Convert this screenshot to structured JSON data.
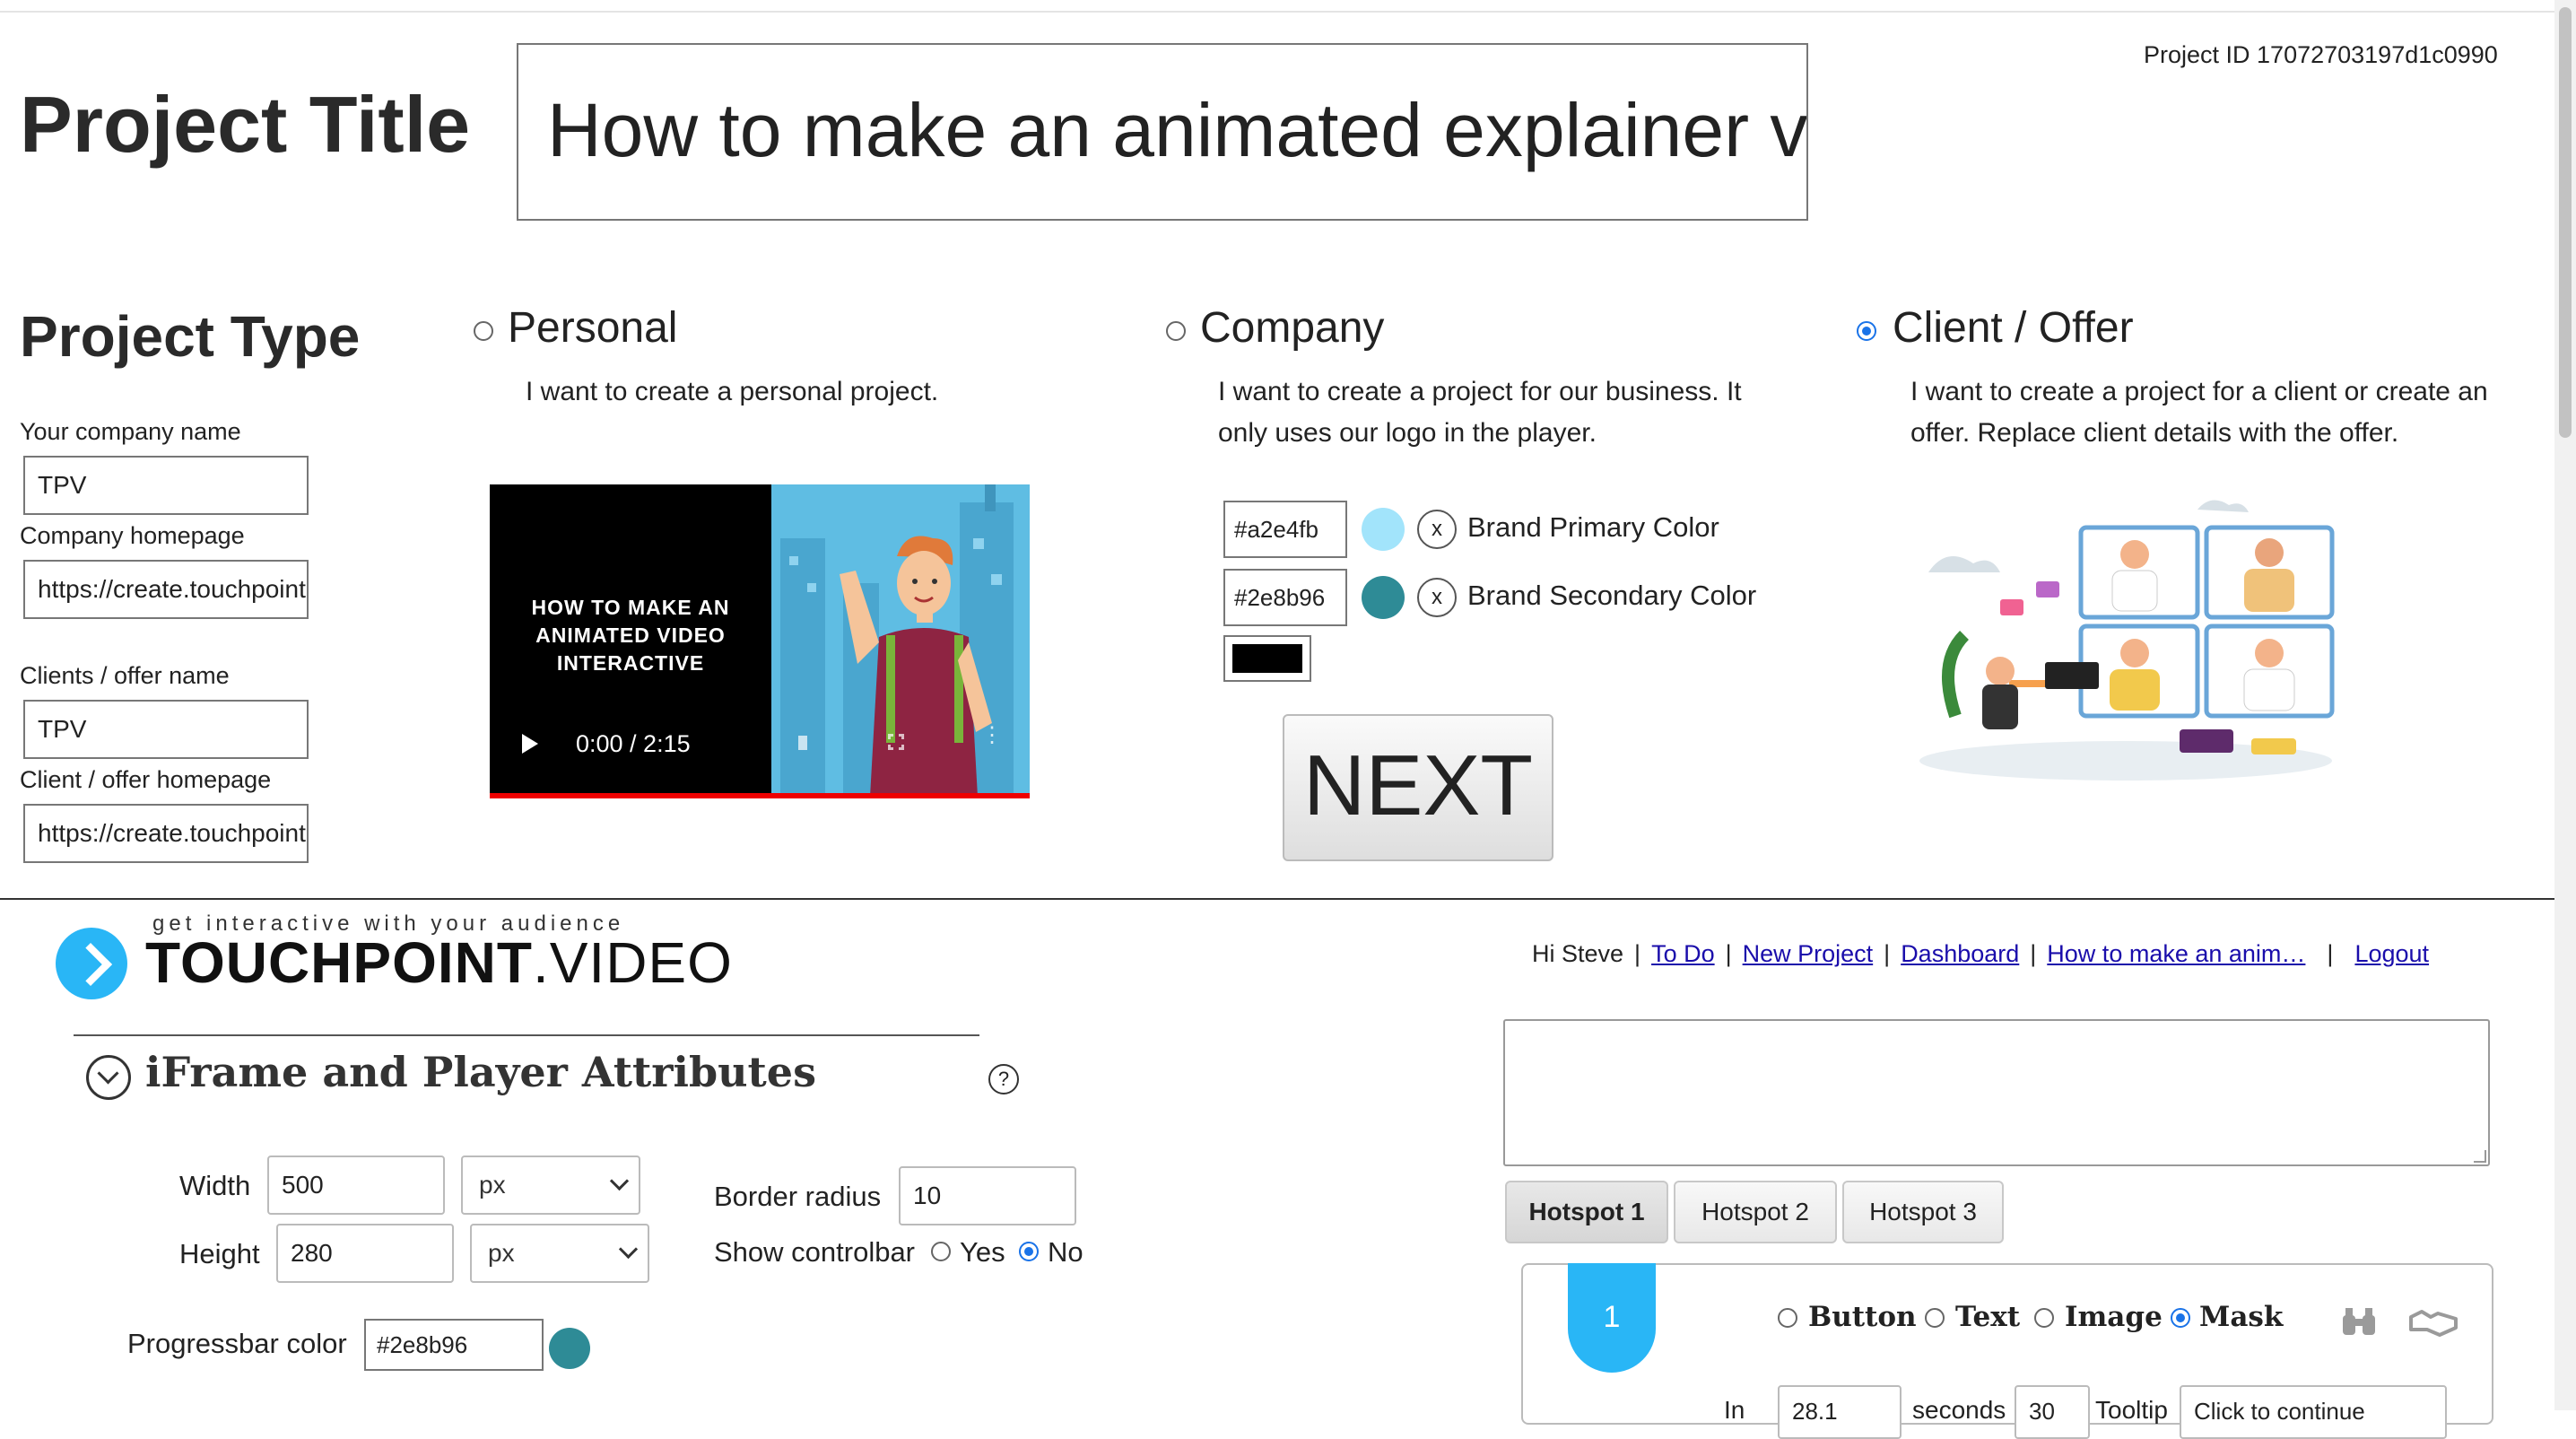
{
  "project": {
    "title_label": "Project Title",
    "title_value": "How to make an animated explainer video interactive",
    "id_text": "Project ID 17072703197d1c0990"
  },
  "project_type": {
    "heading": "Project Type",
    "company_name_label": "Your company name",
    "company_name_value": "TPV",
    "company_homepage_label": "Company homepage",
    "company_homepage_value": "https://create.touchpoint",
    "client_name_label": "Clients / offer name",
    "client_name_value": "TPV",
    "client_homepage_label": "Client / offer homepage",
    "client_homepage_value": "https://create.touchpoint",
    "options": [
      {
        "label": "Personal",
        "desc": "I want to create a personal project.",
        "selected": false
      },
      {
        "label": "Company",
        "desc": "I want to create a project for our business. It only uses our logo in the player.",
        "selected": false
      },
      {
        "label": "Client / Offer",
        "desc": "I want to create a project for a client or create an offer. Replace client details with the offer.",
        "selected": true
      }
    ]
  },
  "video": {
    "caption": "HOW TO MAKE AN ANIMATED VIDEO INTERACTIVE",
    "time": "0:00 / 2:15"
  },
  "brand": {
    "primary_hex": "#a2e4fb",
    "primary_label": "Brand Primary Color",
    "secondary_hex": "#2e8b96",
    "secondary_label": "Brand Secondary Color",
    "third_color": "#000000",
    "remove_glyph": "x"
  },
  "next_label": "NEXT",
  "header": {
    "tagline": "get interactive with your audience",
    "logo_bold": "TOUCHPOINT",
    "logo_light": ".VIDEO",
    "greeting": "Hi Steve",
    "links": [
      "To Do",
      "New Project",
      "Dashboard",
      "How to make an anim…",
      "Logout"
    ]
  },
  "iframe_section": {
    "title": "iFrame and Player Attributes",
    "help_glyph": "?",
    "width_label": "Width",
    "width_value": "500",
    "width_unit": "px",
    "height_label": "Height",
    "height_value": "280",
    "height_unit": "px",
    "border_radius_label": "Border radius",
    "border_radius_value": "10",
    "controlbar_label": "Show controlbar",
    "controlbar_yes": "Yes",
    "controlbar_no": "No",
    "progress_label": "Progressbar color",
    "progress_value": "#2e8b96"
  },
  "hotspots": {
    "tabs": [
      "Hotspot 1",
      "Hotspot 2",
      "Hotspot 3"
    ],
    "active_number": "1",
    "types": [
      "Button",
      "Text",
      "Image",
      "Mask"
    ],
    "selected_type": "Mask",
    "in_label": "In",
    "in_value": "28.1",
    "seconds_label": "seconds",
    "duration_value": "30",
    "tooltip_label": "Tooltip",
    "tooltip_value": "Click to continue"
  },
  "colors": {
    "accent_blue": "#1a73e8",
    "link": "#1a0dab",
    "teal": "#2e8b96",
    "light_blue": "#a2e4fb",
    "tab_blue": "#29b6f6"
  }
}
